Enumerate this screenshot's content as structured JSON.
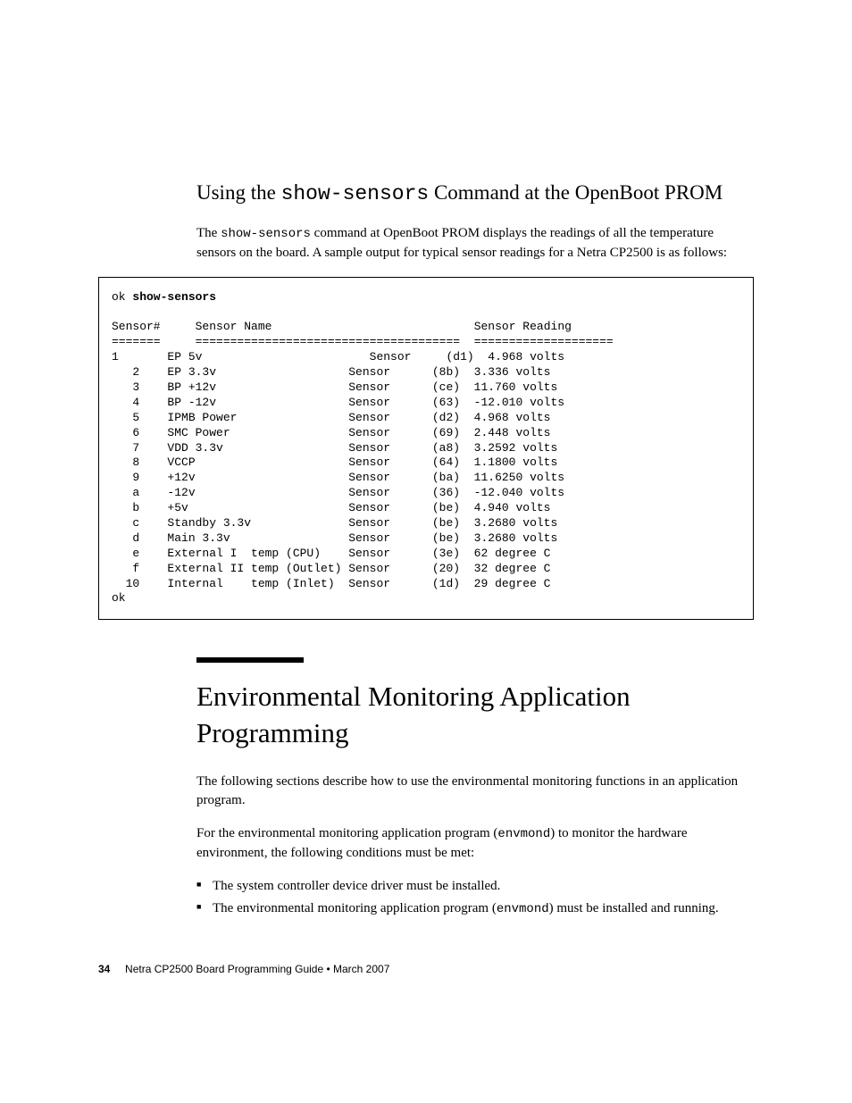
{
  "section1": {
    "heading_pre": "Using the ",
    "heading_cmd": "show-sensors",
    "heading_post": " Command at the OpenBoot PROM",
    "para_pre": "The ",
    "para_cmd": "show-sensors",
    "para_post": " command at OpenBoot PROM displays the readings of all the temperature sensors on the board. A sample output for typical sensor readings for a Netra CP2500 is as follows:"
  },
  "code": {
    "prompt1": "ok ",
    "command": "show-sensors",
    "hdr_sensor": "Sensor#",
    "hdr_name": "Sensor Name",
    "hdr_reading": "Sensor Reading",
    "rule1": "=======",
    "rule2": "======================================",
    "rule3": "====================",
    "rows": [
      {
        "num": "1",
        "pre": "EP ",
        "name": "5v                       ",
        "code": "(d1)",
        "val": " 4.968 volts"
      },
      {
        "num": "   2",
        "pre": "",
        "name": "EP 3.3v                  ",
        "code": " (8b)",
        "val": " 3.336 volts"
      },
      {
        "num": "   3",
        "pre": "",
        "name": "BP +12v                  ",
        "code": " (ce)",
        "val": " 11.760 volts"
      },
      {
        "num": "   4",
        "pre": "",
        "name": "BP -12v                  ",
        "code": " (63)",
        "val": " -12.010 volts"
      },
      {
        "num": "   5",
        "pre": "",
        "name": "IPMB Power               ",
        "code": " (d2)",
        "val": " 4.968 volts"
      },
      {
        "num": "   6",
        "pre": "",
        "name": "SMC Power                ",
        "code": " (69)",
        "val": " 2.448 volts"
      },
      {
        "num": "   7",
        "pre": "",
        "name": "VDD 3.3v                 ",
        "code": " (a8)",
        "val": " 3.2592 volts"
      },
      {
        "num": "   8",
        "pre": "",
        "name": "VCCP                     ",
        "code": " (64)",
        "val": " 1.1800 volts"
      },
      {
        "num": "   9",
        "pre": "",
        "name": "+12v                     ",
        "code": " (ba)",
        "val": " 11.6250 volts"
      },
      {
        "num": "   a",
        "pre": "",
        "name": "-12v                     ",
        "code": " (36)",
        "val": " -12.040 volts"
      },
      {
        "num": "   b",
        "pre": "",
        "name": "+5v                      ",
        "code": " (be)",
        "val": " 4.940 volts"
      },
      {
        "num": "   c",
        "pre": "",
        "name": "Standby 3.3v             ",
        "code": " (be)",
        "val": " 3.2680 volts"
      },
      {
        "num": "   d",
        "pre": "",
        "name": "Main 3.3v                ",
        "code": " (be)",
        "val": " 3.2680 volts"
      },
      {
        "num": "   e",
        "pre": "",
        "name": "External I  temp (CPU)   ",
        "code": " (3e)",
        "val": " 62 degree C"
      },
      {
        "num": "   f",
        "pre": "",
        "name": "External II temp (Outlet)",
        "code": " (20)",
        "val": " 32 degree C"
      },
      {
        "num": "  10",
        "pre": "",
        "name": "Internal    temp (Inlet) ",
        "code": " (1d)",
        "val": " 29 degree C"
      }
    ],
    "word_sensor": "Sensor",
    "prompt2": "ok"
  },
  "section2": {
    "heading": "Environmental Monitoring Application Programming",
    "para1": "The following sections describe how to use the environmental monitoring functions in an application program.",
    "para2_pre": "For the environmental monitoring application program (",
    "para2_cmd": "envmond",
    "para2_post": ") to monitor the hardware environment, the following conditions must be met:",
    "bullet1": "The system controller device driver must be installed.",
    "bullet2_pre": "The environmental monitoring application program (",
    "bullet2_cmd": "envmond",
    "bullet2_post": ") must be installed and running."
  },
  "footer": {
    "page": "34",
    "title": "Netra CP2500 Board Programming Guide  •  March 2007"
  }
}
